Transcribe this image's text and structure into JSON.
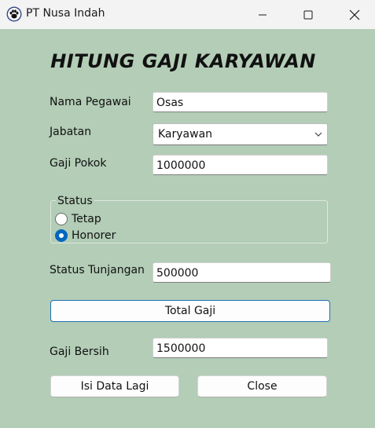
{
  "window": {
    "title": "PT Nusa Indah",
    "icon": "paw-icon",
    "controls": [
      "minimize-icon",
      "maximize-icon",
      "close-icon"
    ]
  },
  "form": {
    "heading": "HITUNG GAJI KARYAWAN",
    "nama_label": "Nama Pegawai",
    "nama_value": "Osas",
    "jabatan_label": "Jabatan",
    "jabatan_value": "Karyawan",
    "gaji_pokok_label": "Gaji Pokok",
    "gaji_pokok_value": "1000000",
    "status_group_label": "Status",
    "status_options": [
      "Tetap",
      "Honorer"
    ],
    "status_selected": "Honorer",
    "tunjangan_label": "Status Tunjangan",
    "tunjangan_value": "500000",
    "total_button": "Total Gaji",
    "gaji_bersih_label": "Gaji Bersih",
    "gaji_bersih_value": "1500000",
    "isi_button": "Isi Data Lagi",
    "close_button": "Close"
  },
  "colors": {
    "background": "#b3cdb6",
    "accent": "#0067c0"
  }
}
